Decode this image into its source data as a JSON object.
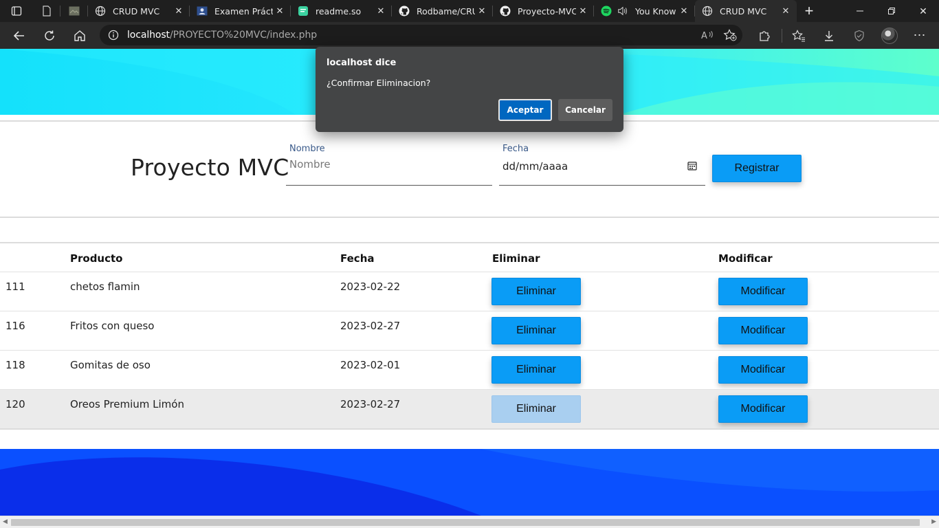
{
  "browser": {
    "tabs": [
      {
        "title": "",
        "icon": "page-icon",
        "pinned": true
      },
      {
        "title": "",
        "icon": "image-thumb-icon",
        "pinned": true
      },
      {
        "title": "CRUD MVC",
        "icon": "globe-icon"
      },
      {
        "title": "Examen Práctic",
        "icon": "portrait-icon"
      },
      {
        "title": "readme.so",
        "icon": "readme-icon"
      },
      {
        "title": "Rodbame/CRUI",
        "icon": "github-icon"
      },
      {
        "title": "Proyecto-MVC/",
        "icon": "github-icon"
      },
      {
        "title": "You Know",
        "icon": "spotify-icon"
      },
      {
        "title": "CRUD MVC",
        "icon": "globe-icon",
        "active": true
      }
    ],
    "address": {
      "host": "localhost",
      "path": "/PROYECTO%20MVC/index.php"
    }
  },
  "dialog": {
    "title": "localhost dice",
    "message": "¿Confirmar Eliminacion?",
    "ok_label": "Aceptar",
    "cancel_label": "Cancelar"
  },
  "form": {
    "title": "Proyecto MVC",
    "nombre_label": "Nombre",
    "nombre_placeholder": "Nombre",
    "fecha_label": "Fecha",
    "fecha_placeholder": "dd/mm/aaaa",
    "submit_label": "Registrar"
  },
  "table": {
    "headers": {
      "id": "",
      "producto": "Producto",
      "fecha": "Fecha",
      "eliminar": "Eliminar",
      "modificar": "Modificar"
    },
    "rows": [
      {
        "id": "111",
        "producto": "chetos flamin",
        "fecha": "2023-02-22",
        "eliminar": "Eliminar",
        "modificar": "Modificar"
      },
      {
        "id": "116",
        "producto": "Fritos con queso",
        "fecha": "2023-02-27",
        "eliminar": "Eliminar",
        "modificar": "Modificar"
      },
      {
        "id": "118",
        "producto": "Gomitas de oso",
        "fecha": "2023-02-01",
        "eliminar": "Eliminar",
        "modificar": "Modificar"
      },
      {
        "id": "120",
        "producto": "Oreos Premium Limón",
        "fecha": "2023-02-27",
        "eliminar": "Eliminar",
        "modificar": "Modificar"
      }
    ]
  },
  "colors": {
    "chrome_dark": "#1f1f1f",
    "button_blue": "#0a9cf6",
    "wave_top_cyan": "#22e6fb",
    "wave_bottom_blue": "#0044ff"
  }
}
